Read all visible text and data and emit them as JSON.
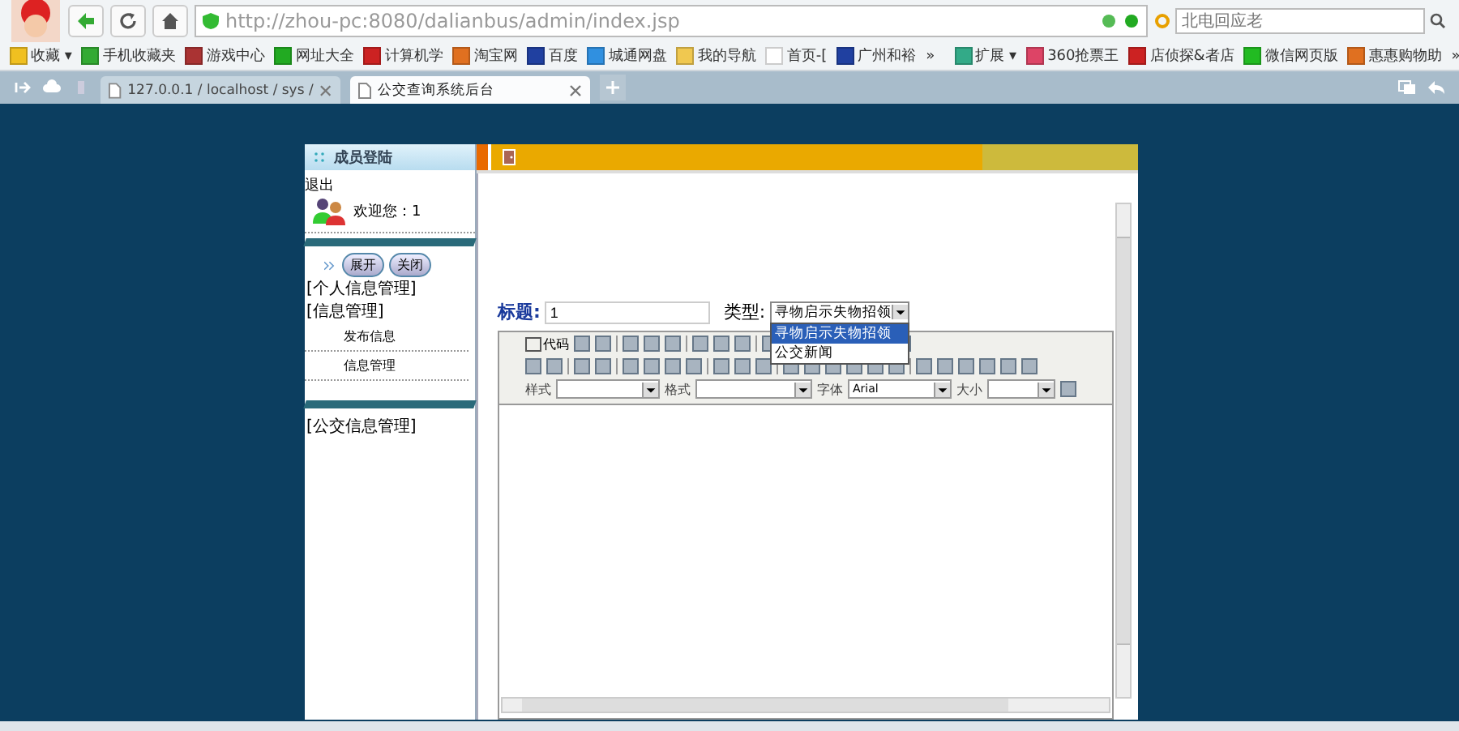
{
  "browser": {
    "url": "http://zhou-pc:8080/dalianbus/admin/index.jsp",
    "search": {
      "placeholder": "北电回应老"
    },
    "bookmarks": [
      {
        "label": "收藏 ▾",
        "kind": "star"
      },
      {
        "label": "手机收藏夹",
        "kind": "phone"
      },
      {
        "label": "游戏中心",
        "kind": "game"
      },
      {
        "label": "网址大全",
        "kind": "globe"
      },
      {
        "label": "计算机学",
        "kind": "red"
      },
      {
        "label": "淘宝网",
        "kind": "orange"
      },
      {
        "label": "百度",
        "kind": "blue"
      },
      {
        "label": "城通网盘",
        "kind": "cloud"
      },
      {
        "label": "我的导航",
        "kind": "folder"
      },
      {
        "label": "首页-[",
        "kind": "page"
      },
      {
        "label": "广州和裕",
        "kind": "blue"
      },
      {
        "label": "»",
        "kind": "text"
      }
    ],
    "bookmarks_right": [
      {
        "label": "扩展 ▾",
        "kind": "grid"
      },
      {
        "label": "360抢票王",
        "kind": "pink"
      },
      {
        "label": "店侦探&者店",
        "kind": "red"
      },
      {
        "label": "微信网页版",
        "kind": "green"
      },
      {
        "label": "惠惠购物助",
        "kind": "orange"
      },
      {
        "label": "»",
        "kind": "text"
      }
    ],
    "tabs": [
      {
        "label": "127.0.0.1 / localhost / sys /",
        "selected": false
      },
      {
        "label": "公交查询系统后台",
        "selected": true
      }
    ]
  },
  "sidebar": {
    "title": "成员登陆",
    "logout": "退出",
    "welcome": "欢迎您：1",
    "expand": "展开",
    "collapse": "关闭",
    "groups": [
      {
        "label": "[个人信息管理]"
      },
      {
        "label": "[信息管理]",
        "children": [
          {
            "label": "发布信息"
          },
          {
            "label": "信息管理"
          }
        ]
      },
      {
        "label": "[公交信息管理]"
      }
    ]
  },
  "form": {
    "title_label": "标题:",
    "title_value": "1",
    "type_label": "类型:",
    "type_value": "寻物启示失物招领",
    "options": [
      {
        "label": "寻物启示失物招领",
        "selected": true
      },
      {
        "label": "公交新闻",
        "selected": false
      }
    ]
  },
  "editor": {
    "code_label": "代码",
    "style_label": "样式",
    "format_label": "格式",
    "font_label": "字体",
    "font_value": "Arial",
    "size_label": "大小"
  }
}
